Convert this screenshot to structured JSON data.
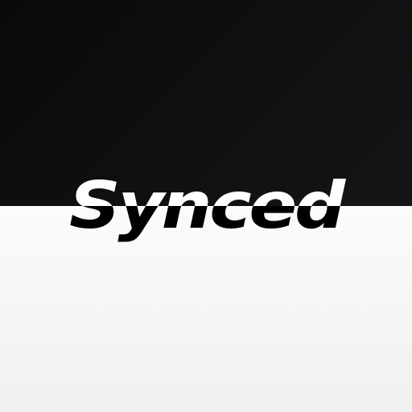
{
  "logo": {
    "wordmark": "Synced",
    "colors": {
      "top_background": "#0f1011",
      "bottom_background": "#f7f7f7",
      "text_on_dark": "#ffffff",
      "text_on_light": "#000000"
    }
  }
}
